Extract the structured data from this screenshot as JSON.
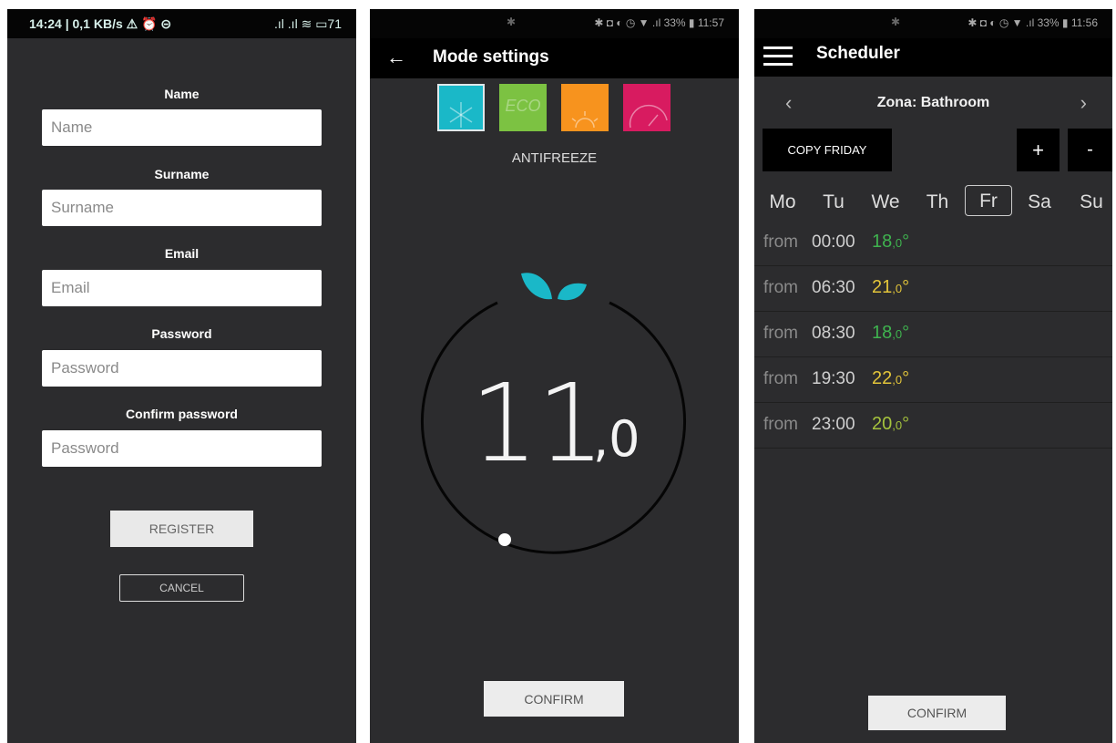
{
  "screen1": {
    "status": {
      "left": "14:24 | 0,1 KB/s ⚠ ⏰ ⊝",
      "right": ".ıl .ıl ≋ ▭71"
    },
    "fields": [
      {
        "label": "Name",
        "placeholder": "Name"
      },
      {
        "label": "Surname",
        "placeholder": "Surname"
      },
      {
        "label": "Email",
        "placeholder": "Email"
      },
      {
        "label": "Password",
        "placeholder": "Password"
      },
      {
        "label": "Confirm password",
        "placeholder": "Password"
      }
    ],
    "register_label": "REGISTER",
    "cancel_label": "CANCEL"
  },
  "screen2": {
    "status": {
      "right": "✱ ◘ ◐ ◷ ▼ .ıl 33% ▮ 11:57"
    },
    "title": "Mode settings",
    "modes": [
      {
        "name": "antifreeze",
        "color": "#1ab8c8",
        "label": "",
        "selected": true
      },
      {
        "name": "eco",
        "color": "#7cc242",
        "label": "ECO",
        "selected": false
      },
      {
        "name": "comfort",
        "color": "#f7931e",
        "label": "",
        "selected": false
      },
      {
        "name": "boost",
        "color": "#d81b60",
        "label": "",
        "selected": false
      }
    ],
    "mode_name": "ANTIFREEZE",
    "temp_int": "11",
    "temp_dec": ",0",
    "leaf_color": "#1ab8c8",
    "confirm_label": "CONFIRM"
  },
  "screen3": {
    "status": {
      "right": "✱ ◘ ◐ ◷ ▼ .ıl 33% ▮ 11:56"
    },
    "title": "Scheduler",
    "zone": "Zona: Bathroom",
    "copy_label": "COPY FRIDAY",
    "plus_label": "+",
    "minus_label": "-",
    "days": [
      "Mo",
      "Tu",
      "We",
      "Th",
      "Fr",
      "Sa",
      "Su"
    ],
    "selected_day": "Fr",
    "slots": [
      {
        "from": "from",
        "time": "00:00",
        "temp": "18",
        "dec": ",0",
        "unit": "°",
        "color": "#3fb34f"
      },
      {
        "from": "from",
        "time": "06:30",
        "temp": "21",
        "dec": ",0",
        "unit": "°",
        "color": "#e3c53a"
      },
      {
        "from": "from",
        "time": "08:30",
        "temp": "18",
        "dec": ",0",
        "unit": "°",
        "color": "#3fb34f"
      },
      {
        "from": "from",
        "time": "19:30",
        "temp": "22",
        "dec": ",0",
        "unit": "°",
        "color": "#e3c53a"
      },
      {
        "from": "from",
        "time": "23:00",
        "temp": "20",
        "dec": ",0",
        "unit": "°",
        "color": "#a5c33d"
      }
    ],
    "confirm_label": "CONFIRM"
  }
}
